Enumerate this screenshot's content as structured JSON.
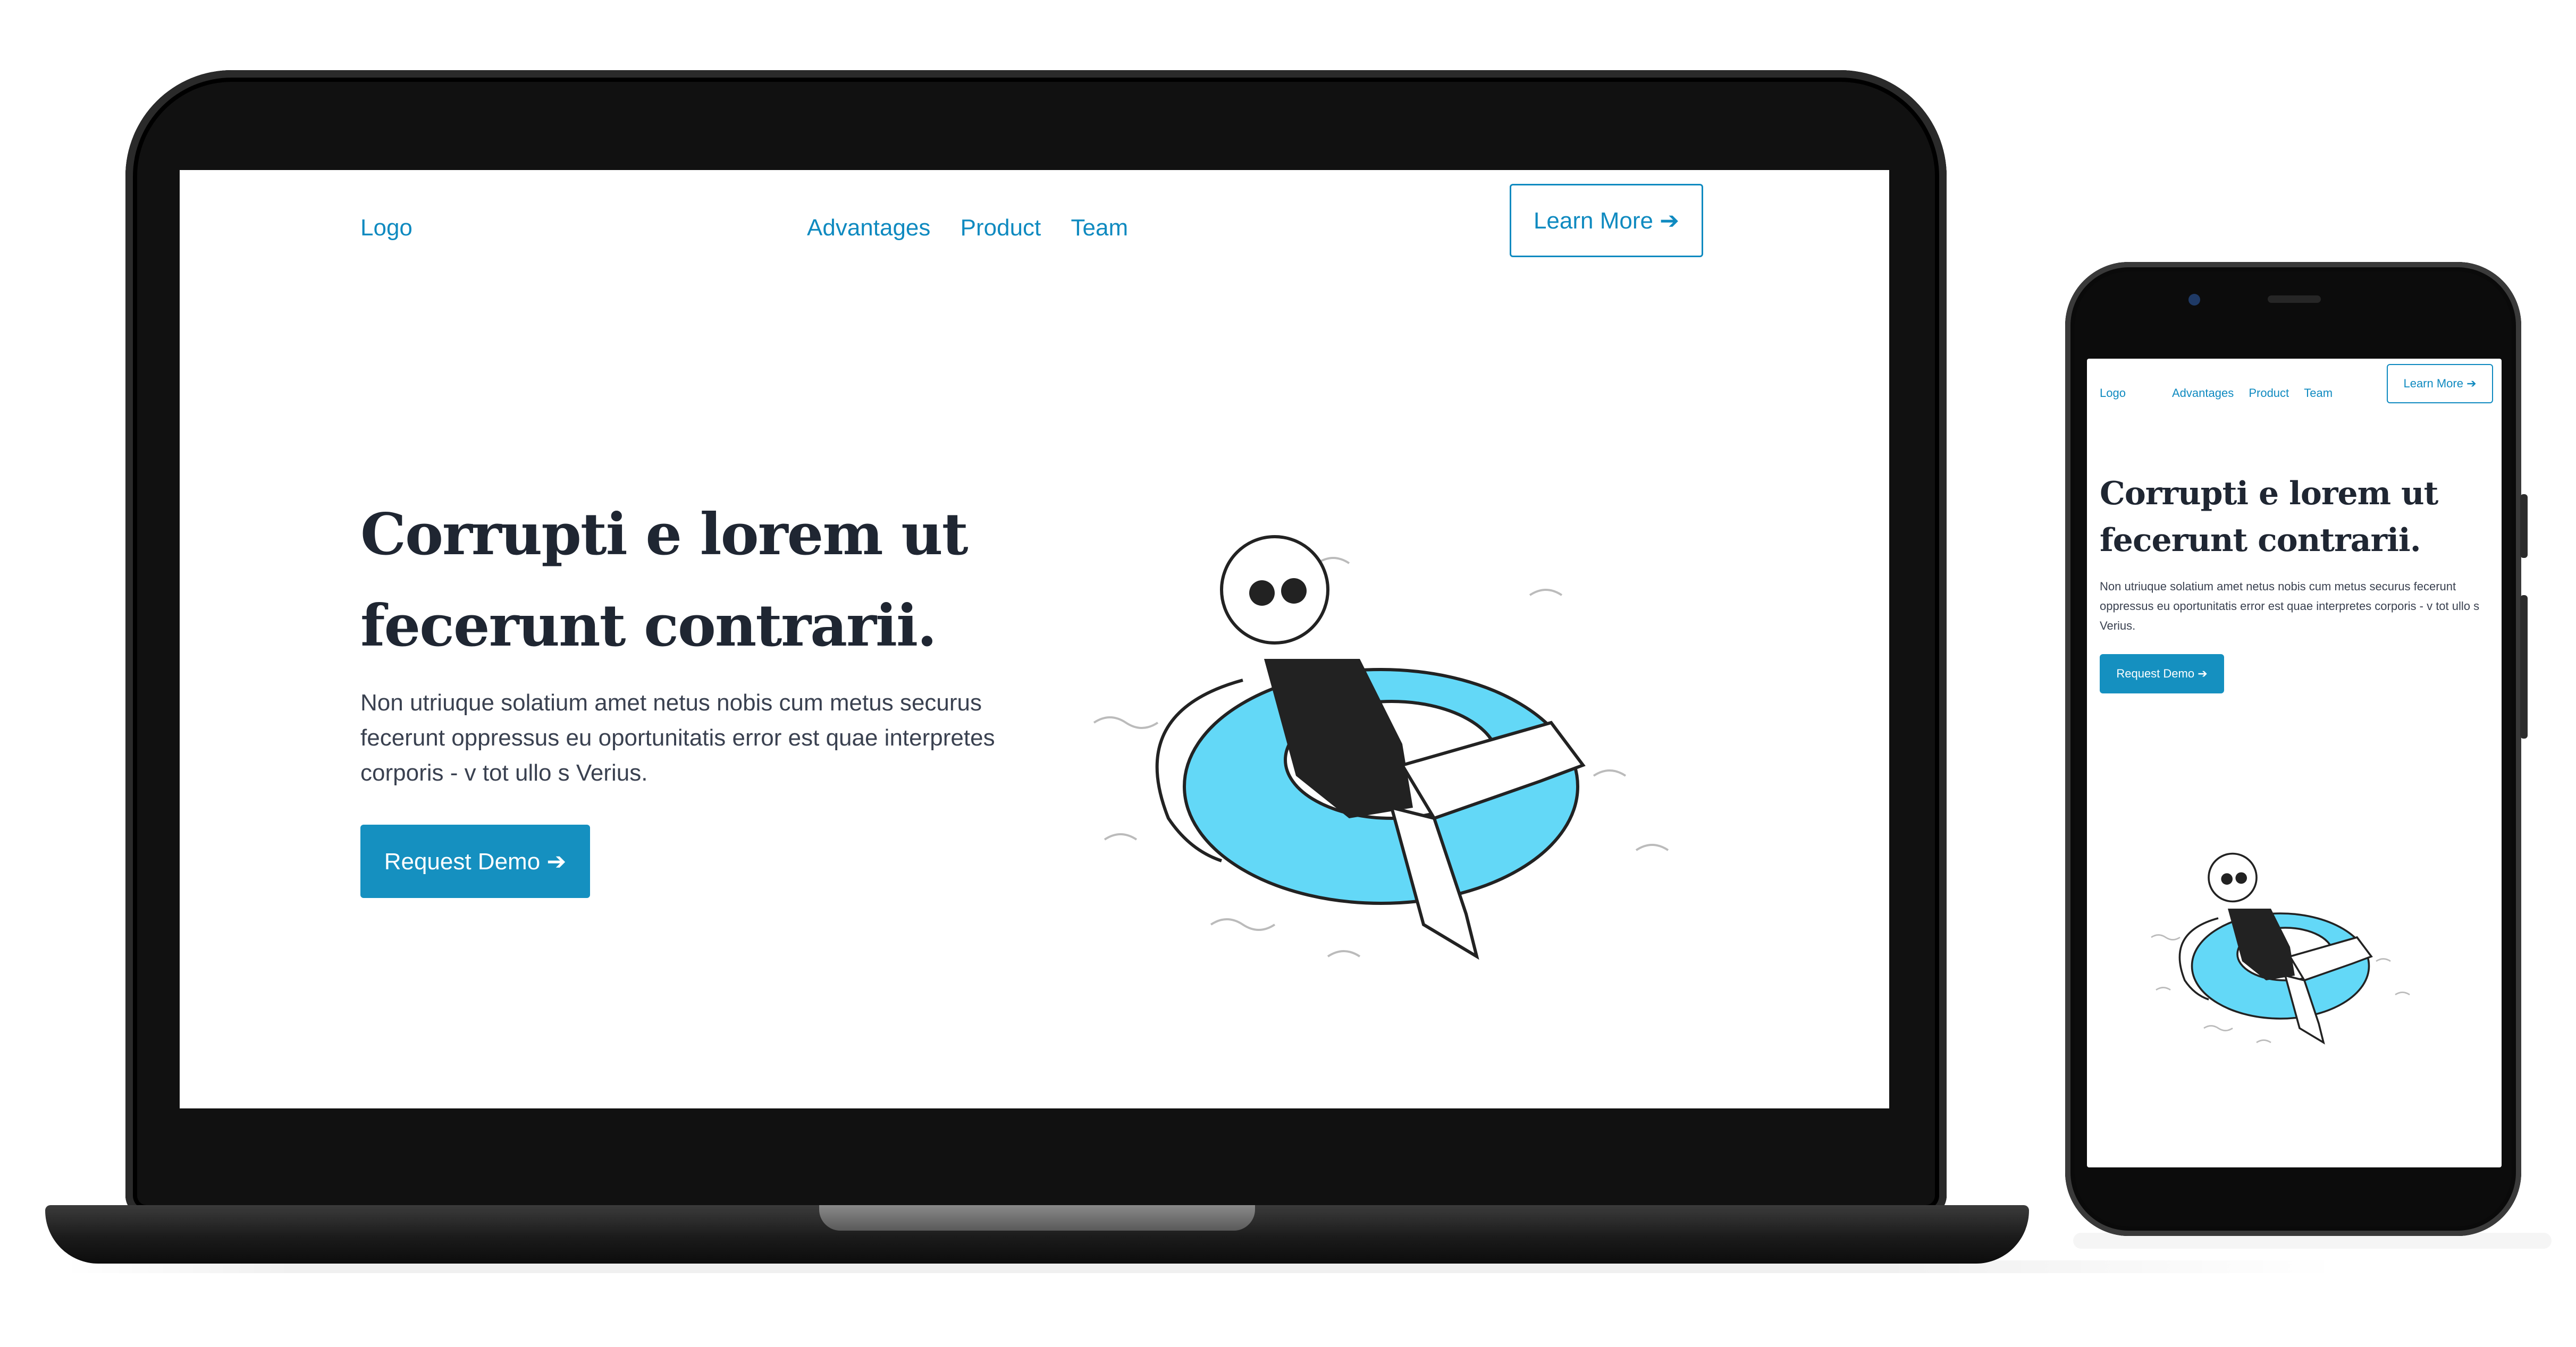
{
  "site": {
    "logo": "Logo",
    "nav": [
      "Advantages",
      "Product",
      "Team"
    ],
    "learn_more": "Learn More ➔",
    "headline_line1": "Corrupti e lorem ut",
    "headline_line2": "fecerunt contrarii.",
    "paragraph": "Non utriuque solatium amet netus nobis cum metus securus fecerunt oppressus eu oportunitatis error est quae interpretes corporis - v tot ullo s Verius.",
    "request_demo": "Request Demo ➔",
    "illustration": "woman-on-swim-ring"
  },
  "colors": {
    "accent": "#0f8ac0",
    "button_fill": "#1590c0",
    "headline": "#1f2632",
    "ring": "#63d8f7"
  }
}
